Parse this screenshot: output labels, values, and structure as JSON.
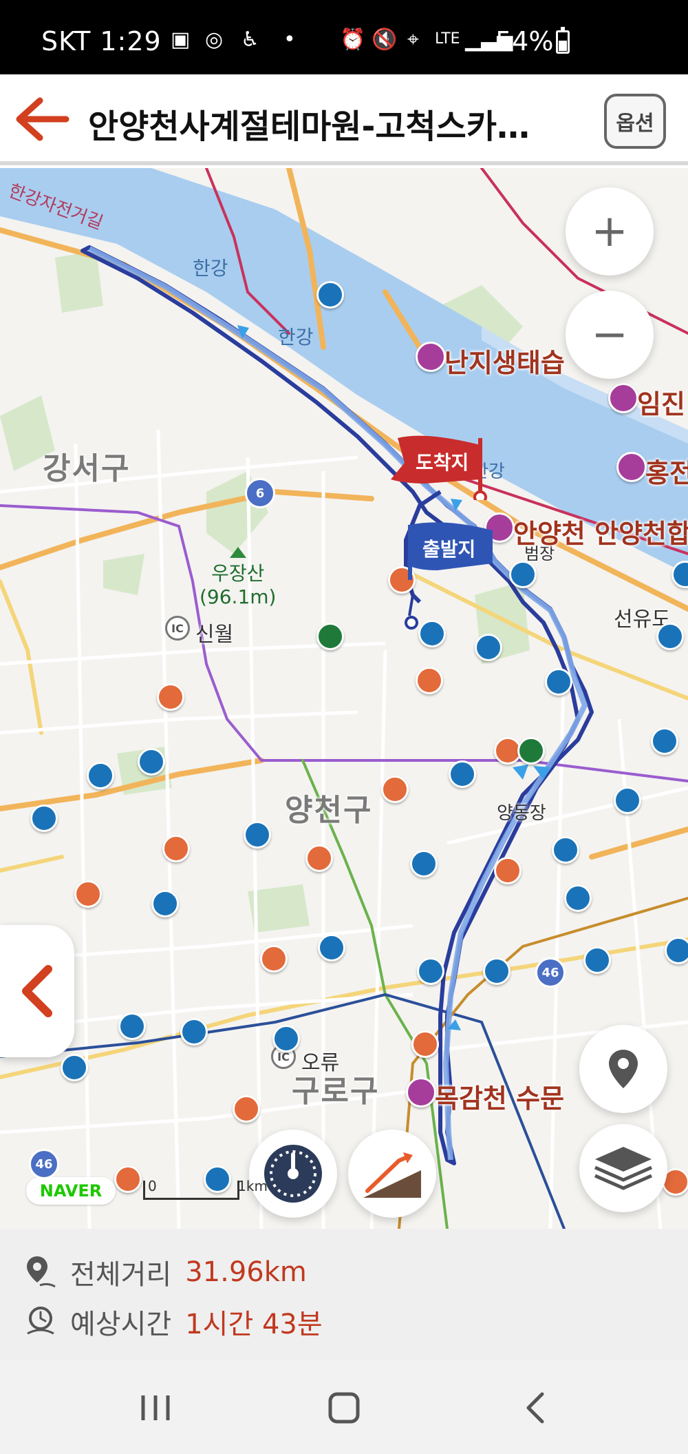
{
  "status_bar": {
    "carrier_time": "SKT 1:29",
    "network": "LTE",
    "battery": "54%"
  },
  "header": {
    "title": "안양천사계절테마원-고척스카이...",
    "options_label": "옵션",
    "back_icon": "arrow-left-icon",
    "accent_color": "#d2401f"
  },
  "map": {
    "districts": [
      "강서구",
      "양천구",
      "구로구"
    ],
    "river_labels": [
      "한강",
      "한강",
      "한강자전거길",
      "한강"
    ],
    "places": [
      "신월",
      "오류",
      "선유도",
      "범장",
      "양동장"
    ],
    "mountain": {
      "name": "우장산",
      "elevation": "(96.1m)"
    },
    "bike_pois": [
      "난지생태습",
      "임진",
      "홍전",
      "안양천 안양천합",
      "목감천 수문"
    ],
    "start_flag": "출발지",
    "end_flag": "도착지",
    "hw_numbers": [
      "6",
      "46",
      "46"
    ],
    "ic_label": "IC",
    "naver": "NAVER",
    "scale": {
      "zero": "0",
      "unit": "1km"
    }
  },
  "controls": {
    "zoom_in": "+",
    "zoom_out": "−"
  },
  "info": {
    "distance_label": "전체거리",
    "distance_value": "31.96km",
    "time_label": "예상시간",
    "time_value": "1시간 43분"
  }
}
